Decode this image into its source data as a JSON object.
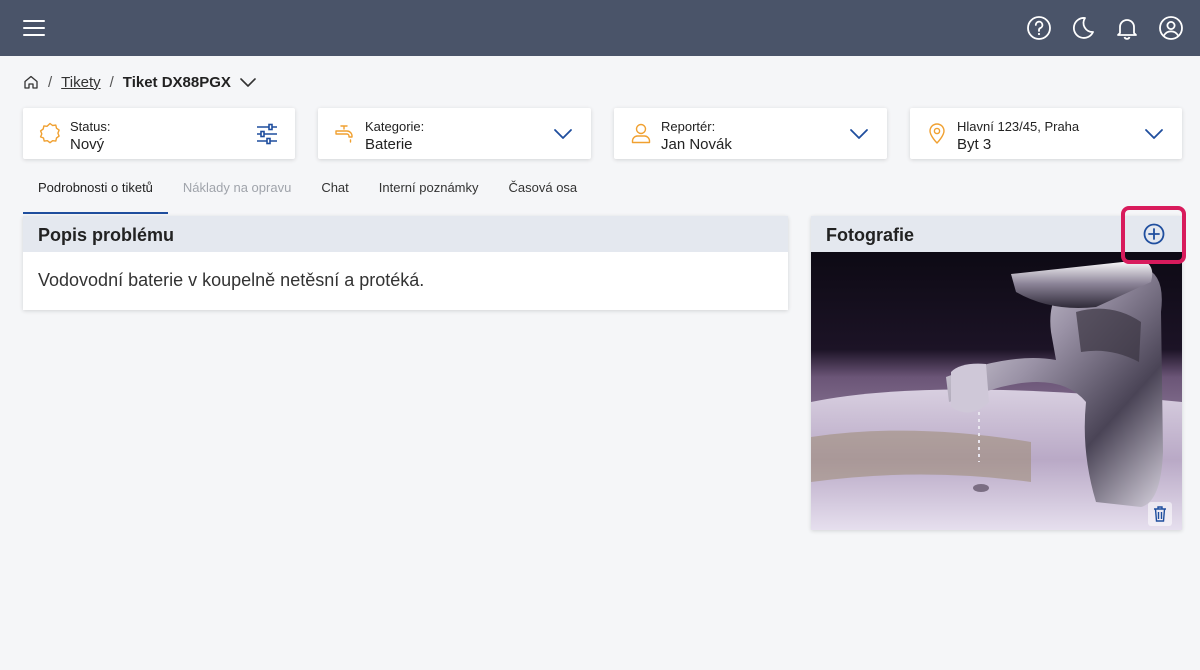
{
  "header": {
    "icons": [
      "menu-icon",
      "help-icon",
      "dark-mode-icon",
      "notifications-icon",
      "account-icon"
    ],
    "background": "#4a5469"
  },
  "breadcrumb": {
    "parent_link": "Tikety",
    "current": "Tiket DX88PGX"
  },
  "cards": {
    "status": {
      "label": "Status:",
      "value": "Nový"
    },
    "category": {
      "label": "Kategorie:",
      "value": "Baterie"
    },
    "reporter": {
      "label": "Reportér:",
      "value": "Jan Novák"
    },
    "address": {
      "label": "Hlavní 123/45, Praha",
      "value": "Byt 3"
    }
  },
  "tabs": [
    {
      "label": "Podrobnosti o tiketů",
      "state": "active"
    },
    {
      "label": "Náklady na opravu",
      "state": "disabled"
    },
    {
      "label": "Chat",
      "state": "normal"
    },
    {
      "label": "Interní poznámky",
      "state": "normal"
    },
    {
      "label": "Časová osa",
      "state": "normal"
    }
  ],
  "problem": {
    "title": "Popis problému",
    "text": "Vodovodní baterie v koupelně netěsní a protéká."
  },
  "photos": {
    "title": "Fotografie"
  },
  "colors": {
    "accent": "#1f4e9e",
    "icon_orange": "#f0a030",
    "highlight": "#d81b5c"
  }
}
